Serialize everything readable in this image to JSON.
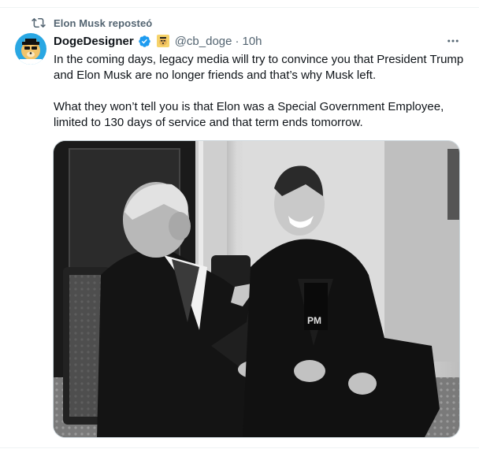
{
  "repost": {
    "icon": "repost-icon",
    "text": "Elon Musk reposteó"
  },
  "tweet": {
    "author": {
      "name": "DogeDesigner",
      "verified_icon": "verified-badge-icon",
      "badge_icon": "doge-affiliate-badge",
      "handle": "@cb_doge",
      "separator": "·",
      "time": "10h"
    },
    "more_icon": "more-options-icon",
    "text": {
      "paragraph1": "In the coming days, legacy media will try to convince you that President Trump and Elon Musk are no longer friends and that’s why Musk left.",
      "paragraph2": "What they won’t tell you is that Elon was a Special Government Employee, limited to 130 days of service and that term ends tomorrow."
    },
    "media": {
      "kind": "black-and-white photo of two men seated in chairs, one pointing and one laughing"
    }
  },
  "colors": {
    "text_primary": "#0f1419",
    "text_secondary": "#536471",
    "verified_blue": "#1d9bf0",
    "border": "#cfd9de"
  }
}
